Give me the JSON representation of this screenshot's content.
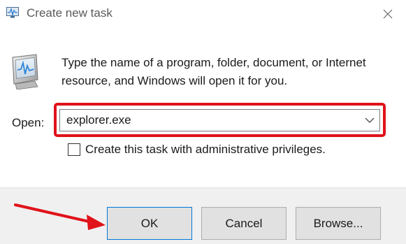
{
  "window": {
    "title": "Create new task",
    "icon": "task-manager-icon",
    "close_icon": "close-icon"
  },
  "body": {
    "description": "Type the name of a program, folder, document, or Internet resource, and Windows will open it for you.",
    "icon": "monitor-activity-icon"
  },
  "open_field": {
    "label": "Open:",
    "value": "explorer.exe",
    "dropdown_icon": "chevron-down-icon"
  },
  "admin_checkbox": {
    "label": "Create this task with administrative privileges.",
    "checked": false
  },
  "buttons": {
    "ok": "OK",
    "cancel": "Cancel",
    "browse": "Browse..."
  },
  "annotations": {
    "highlight_color": "#e0121a",
    "arrow_color": "#e0121a"
  }
}
